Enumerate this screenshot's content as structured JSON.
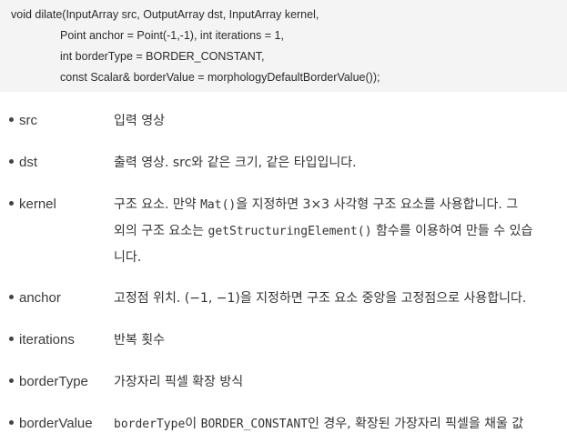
{
  "code": {
    "lines": [
      "void dilate(InputArray src, OutputArray dst, InputArray kernel,",
      "Point anchor = Point(-1,-1), int iterations = 1,",
      "int borderType = BORDER_CONSTANT,",
      "const Scalar& borderValue = morphologyDefaultBorderValue());"
    ]
  },
  "params": [
    {
      "name": "src",
      "desc": "입력 영상"
    },
    {
      "name": "dst",
      "desc": "출력 영상. src와 같은 크기, 같은 타입입니다."
    },
    {
      "name": "kernel",
      "desc_l1_a": "구조 요소. 만약 ",
      "desc_l1_code": "Mat()",
      "desc_l1_b": "을 지정하면 3×3 사각형 구조 요소를 사용합니다. 그",
      "desc_l2_a": "외의 구조 요소는 ",
      "desc_l2_code": "getStructuringElement()",
      "desc_l2_b": " 함수를 이용하여 만들 수 있습",
      "desc_l3": "니다."
    },
    {
      "name": "anchor",
      "desc": "고정점 위치. (−1, −1)을 지정하면 구조 요소 중앙을 고정점으로 사용합니다."
    },
    {
      "name": "iterations",
      "desc": "반복 횟수"
    },
    {
      "name": "borderType",
      "desc": "가장자리 픽셀 확장 방식"
    },
    {
      "name": "borderValue",
      "desc_code1": "borderType",
      "desc_a": "이 ",
      "desc_code2": "BORDER_CONSTANT",
      "desc_b": "인 경우, 확장된 가장자리 픽셀을 채울 값"
    }
  ]
}
